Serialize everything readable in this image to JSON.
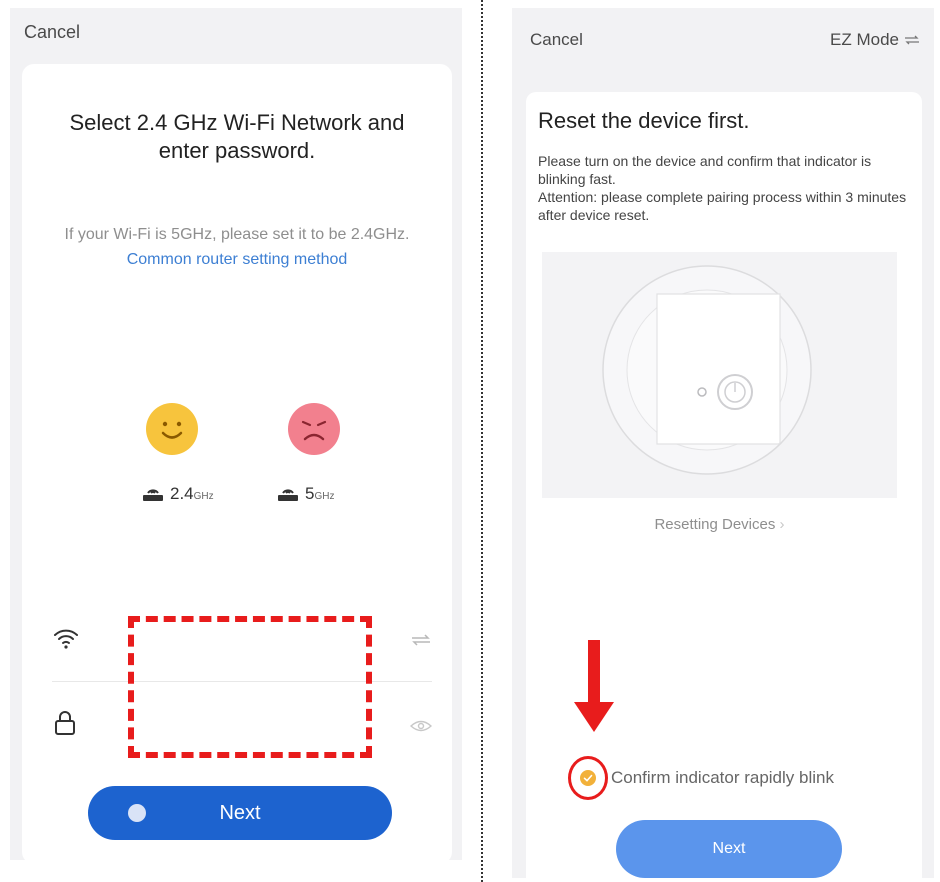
{
  "left_screen": {
    "cancel": "Cancel",
    "title": "Select 2.4 GHz Wi-Fi Network and enter password.",
    "subtitle": "If your Wi-Fi is 5GHz, please set it to be 2.4GHz.",
    "router_link": "Common router setting method",
    "band_24": {
      "value": "2.4",
      "unit": "GHz"
    },
    "band_5": {
      "value": "5",
      "unit": "GHz"
    },
    "wifi_field": {
      "value": "",
      "icon": "wifi-icon"
    },
    "password_field": {
      "value": "",
      "icon": "lock-icon"
    },
    "next": "Next"
  },
  "right_screen": {
    "cancel": "Cancel",
    "mode": "EZ Mode",
    "title": "Reset the device first.",
    "description": [
      "Please turn on the device and confirm that indicator is blinking fast.",
      "Attention: please complete pairing process within 3 minutes after device reset."
    ],
    "resetting_link": "Resetting Devices",
    "confirm_label": "Confirm indicator rapidly blink",
    "next": "Next"
  },
  "colors": {
    "primary_blue": "#1d63cf",
    "light_blue": "#5b95ec",
    "link_blue": "#3d7fd3",
    "annotation_red": "#e81c1c",
    "check_yellow": "#f2b13a",
    "happy_face": "#f7c43d",
    "sad_face": "#f2808e"
  }
}
